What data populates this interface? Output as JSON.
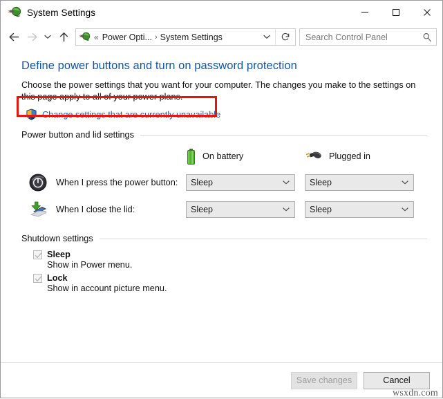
{
  "window": {
    "title": "System Settings",
    "icon": "power-plug-icon",
    "controls": {
      "minimize": "minimize-icon",
      "maximize": "maximize-icon",
      "close": "close-icon"
    }
  },
  "nav": {
    "back": "back-arrow-icon",
    "forward": "forward-arrow-icon",
    "recent": "chevron-down-icon",
    "up": "up-arrow-icon",
    "address_icon": "power-plug-icon",
    "breadcrumb": {
      "lead": "«",
      "items": [
        "Power Opti...",
        "System Settings"
      ],
      "separator": "›"
    },
    "address_chevron": "chevron-down-icon",
    "refresh": "refresh-icon"
  },
  "search": {
    "placeholder": "Search Control Panel",
    "value": "",
    "icon": "search-icon"
  },
  "page": {
    "title": "Define power buttons and turn on password protection",
    "intro": "Choose the power settings that you want for your computer. The changes you make to the settings on this page apply to all of your power plans.",
    "uac_link": "Change settings that are currently unavailable",
    "uac_icon": "uac-shield-icon",
    "highlight_color": "#e8140f"
  },
  "sections": {
    "power_lid": {
      "heading": "Power button and lid settings",
      "columns": [
        {
          "label": "On battery",
          "icon": "battery-icon"
        },
        {
          "label": "Plugged in",
          "icon": "power-plug-icon"
        }
      ],
      "rows": [
        {
          "label": "When I press the power button:",
          "icon": "power-button-icon",
          "on_battery": "Sleep",
          "plugged_in": "Sleep"
        },
        {
          "label": "When I close the lid:",
          "icon": "laptop-lid-icon",
          "on_battery": "Sleep",
          "plugged_in": "Sleep"
        }
      ]
    },
    "shutdown": {
      "heading": "Shutdown settings",
      "options": [
        {
          "label": "Sleep",
          "description": "Show in Power menu.",
          "checked": true
        },
        {
          "label": "Lock",
          "description": "Show in account picture menu.",
          "checked": true
        }
      ]
    }
  },
  "footer": {
    "save_label": "Save changes",
    "cancel_label": "Cancel",
    "watermark": "wsxdn.com"
  }
}
